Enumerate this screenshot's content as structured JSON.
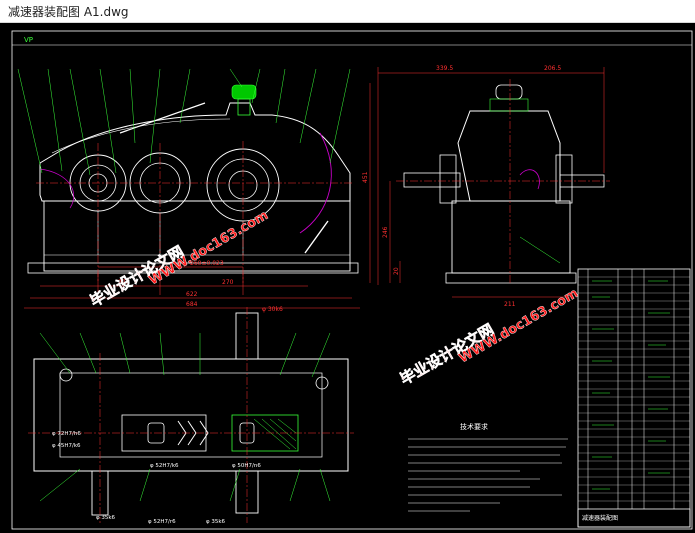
{
  "window": {
    "title": "减速器装配图 A1.dwg"
  },
  "drawing": {
    "layout_tab": "VP",
    "dims_front": {
      "d1": "270",
      "d2": "270",
      "total1": "622",
      "total2": "684",
      "center": "260±0.023",
      "bore": "φ 30k6"
    },
    "dims_side": {
      "w_left": "339.5",
      "w_right": "206.5",
      "w_bottom": "211",
      "height": "451",
      "h_mid": "246",
      "h_low": "20"
    },
    "plan_labels": {
      "fit1": "φ 72H7/h6",
      "fit2": "φ 45H7/k6",
      "fit3": "φ 52H7/k6",
      "fit4": "φ 35k6",
      "fit5": "φ 52H7/r6",
      "fit6": "φ 50H7/n6",
      "fit7": "φ 35k6"
    },
    "tech_req_title": "技术要求",
    "watermark_site": "WWW.doc163.com",
    "watermark_cn": "毕业设计论文网",
    "title_block_label": "减速器装配图",
    "colors": {
      "outline": "#ffffff",
      "dim": "#ff3030",
      "leader": "#39ff39",
      "center": "#ff3030",
      "green_fill": "#00c800",
      "watermark": "#ff1a1a",
      "magenta": "#c800c8"
    }
  }
}
